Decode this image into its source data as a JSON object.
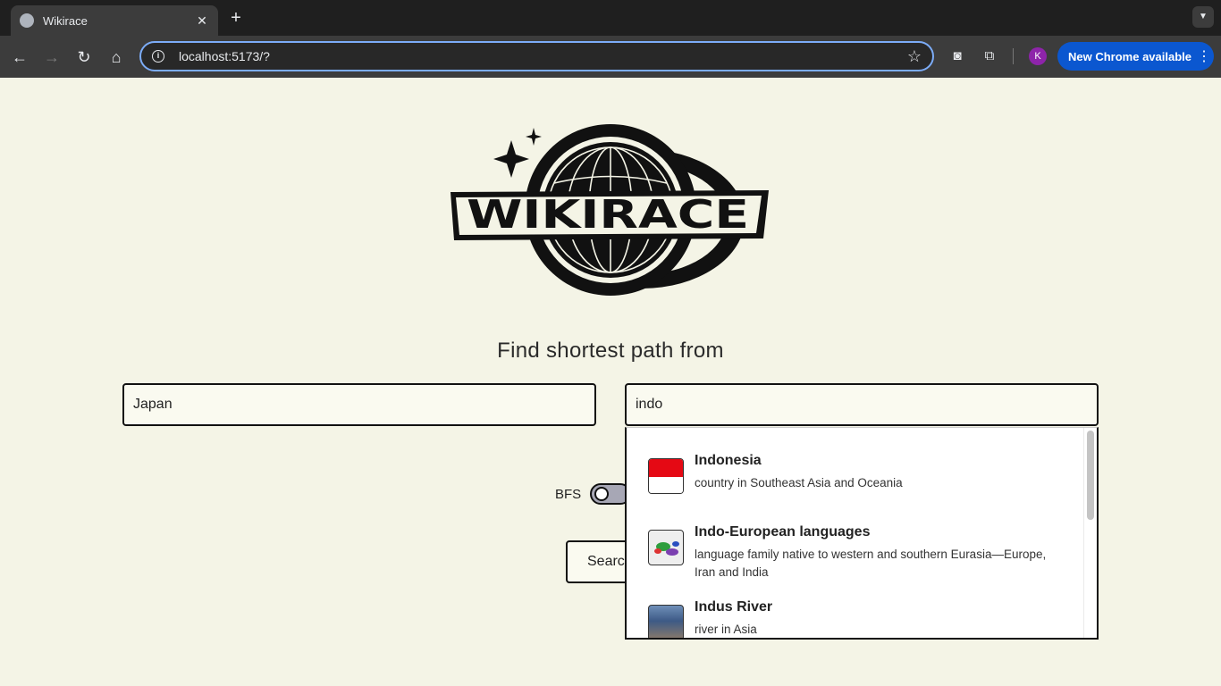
{
  "browser": {
    "tab_title": "Wikirace",
    "url": "localhost:5173/?",
    "profile_initial": "K",
    "update_label": "New Chrome available"
  },
  "app": {
    "logo_text": "WIKIRACE",
    "heading": "Find shortest path from",
    "start_value": "Japan",
    "end_value": "indo",
    "algorithm_label": "BFS",
    "search_label": "Searc"
  },
  "suggestions": [
    {
      "title": "Indonesia",
      "description": "country in Southeast Asia and Oceania",
      "thumb_icon": "indonesia-flag-icon"
    },
    {
      "title": "Indo-European languages",
      "description": "language family native to western and southern Eurasia—Europe, Iran and India",
      "thumb_icon": "language-map-icon"
    },
    {
      "title": "Indus River",
      "description": "river in Asia",
      "thumb_icon": "river-photo-icon"
    }
  ],
  "colors": {
    "page_background": "#f4f4e6",
    "accent_blue": "#0b57d0",
    "flag_red": "#e50914"
  }
}
